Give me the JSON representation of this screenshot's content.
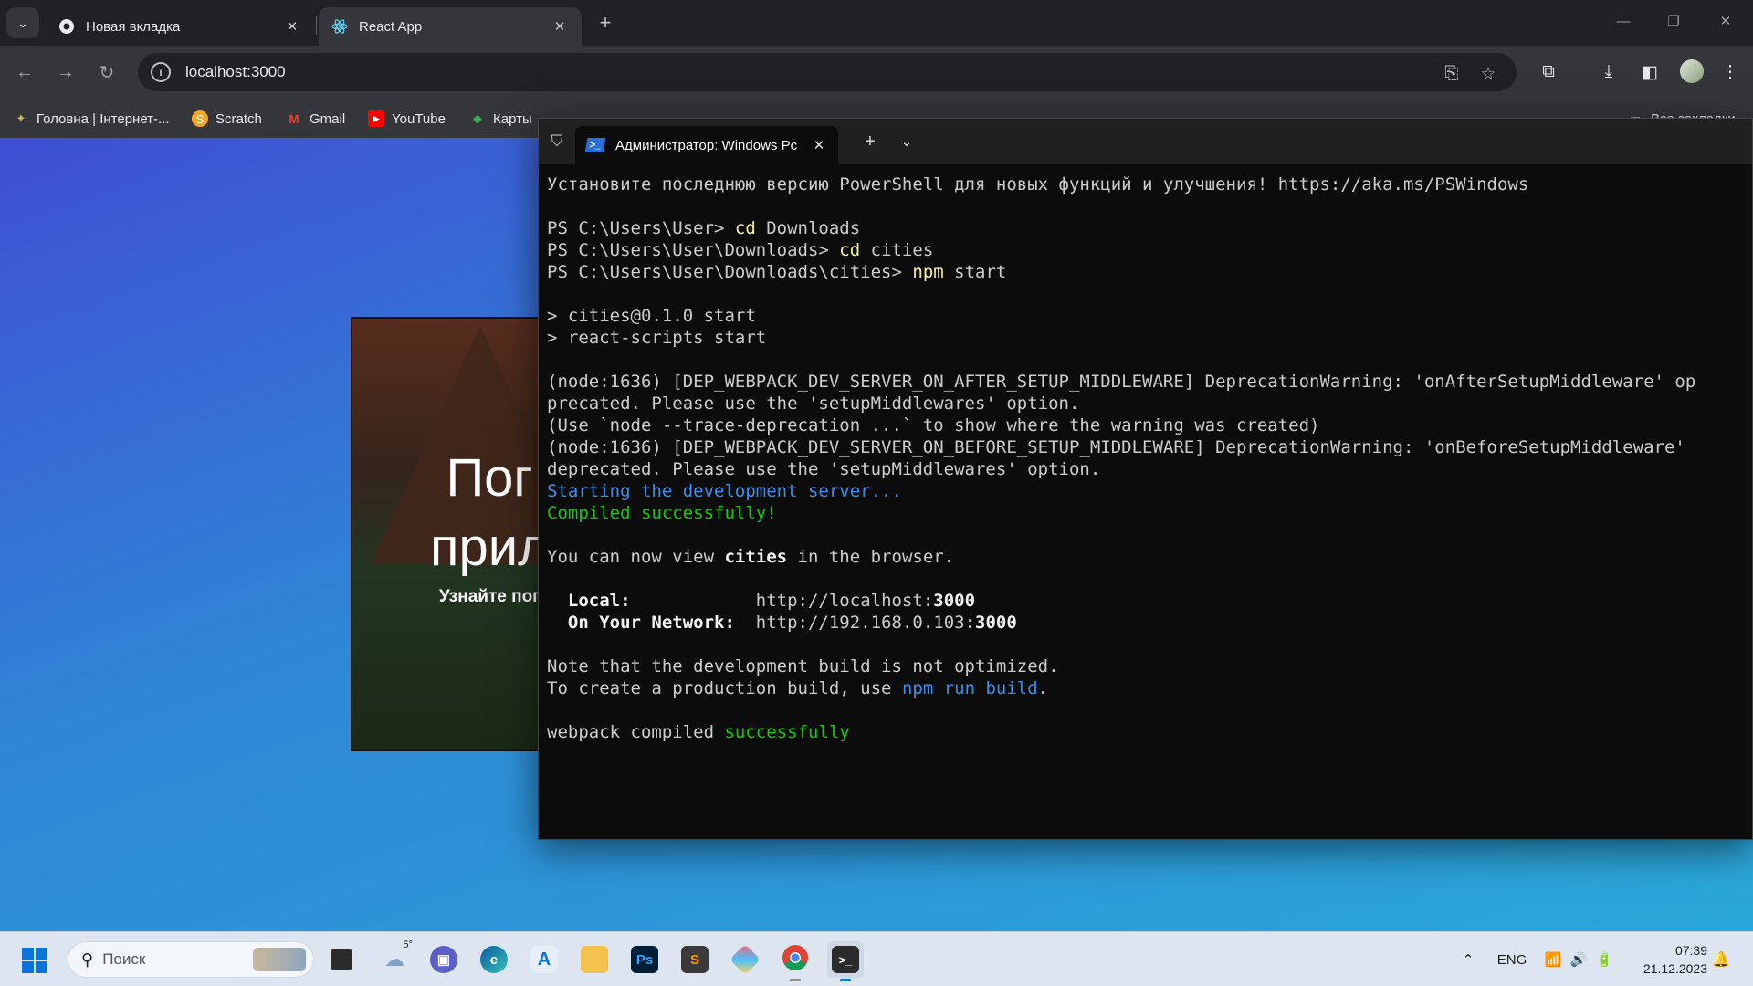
{
  "browser": {
    "tabs": [
      {
        "label": "Новая вкладка",
        "active": false
      },
      {
        "label": "React App",
        "active": true
      }
    ],
    "url": "localhost:3000",
    "bookmarks": [
      {
        "label": "Головна | Інтернет-..."
      },
      {
        "label": "Scratch"
      },
      {
        "label": "Gmail"
      },
      {
        "label": "YouTube"
      },
      {
        "label": "Карты"
      }
    ],
    "all_bookmarks_label": "Все закладки"
  },
  "page": {
    "hero_title_line1": "Пог",
    "hero_title_line2": "прил",
    "hero_subtitle": "Узнайте пог"
  },
  "terminal": {
    "tab_title": "Администратор: Windows Pc",
    "lines": [
      [
        {
          "t": "Установите последнюю версию PowerShell для новых функций и улучшения! https://aka.ms/PSWindows",
          "c": ""
        }
      ],
      [],
      [
        {
          "t": "PS C:\\Users\\User> ",
          "c": ""
        },
        {
          "t": "cd",
          "c": "yel"
        },
        {
          "t": " Downloads",
          "c": ""
        }
      ],
      [
        {
          "t": "PS C:\\Users\\User\\Downloads> ",
          "c": ""
        },
        {
          "t": "cd",
          "c": "yel"
        },
        {
          "t": " cities",
          "c": ""
        }
      ],
      [
        {
          "t": "PS C:\\Users\\User\\Downloads\\cities> ",
          "c": ""
        },
        {
          "t": "npm",
          "c": "yel"
        },
        {
          "t": " start",
          "c": ""
        }
      ],
      [],
      [
        {
          "t": "> cities@0.1.0 start",
          "c": ""
        }
      ],
      [
        {
          "t": "> react-scripts start",
          "c": ""
        }
      ],
      [],
      [
        {
          "t": "(node:1636) [DEP_WEBPACK_DEV_SERVER_ON_AFTER_SETUP_MIDDLEWARE] DeprecationWarning: 'onAfterSetupMiddleware' op",
          "c": ""
        }
      ],
      [
        {
          "t": "precated. Please use the 'setupMiddlewares' option.",
          "c": ""
        }
      ],
      [
        {
          "t": "(Use `node --trace-deprecation ...` to show where the warning was created)",
          "c": ""
        }
      ],
      [
        {
          "t": "(node:1636) [DEP_WEBPACK_DEV_SERVER_ON_BEFORE_SETUP_MIDDLEWARE] DeprecationWarning: 'onBeforeSetupMiddleware'",
          "c": ""
        }
      ],
      [
        {
          "t": "deprecated. Please use the 'setupMiddlewares' option.",
          "c": ""
        }
      ],
      [
        {
          "t": "Starting the development server...",
          "c": "blue"
        }
      ],
      [
        {
          "t": "Compiled successfully!",
          "c": "grn2"
        }
      ],
      [],
      [
        {
          "t": "You can now view ",
          "c": ""
        },
        {
          "t": "cities",
          "c": "bold"
        },
        {
          "t": " in the browser.",
          "c": ""
        }
      ],
      [],
      [
        {
          "t": "  ",
          "c": ""
        },
        {
          "t": "Local:",
          "c": "bold"
        },
        {
          "t": "            http://localhost:",
          "c": ""
        },
        {
          "t": "3000",
          "c": "bold"
        }
      ],
      [
        {
          "t": "  ",
          "c": ""
        },
        {
          "t": "On Your Network:",
          "c": "bold"
        },
        {
          "t": "  http://192.168.0.103:",
          "c": ""
        },
        {
          "t": "3000",
          "c": "bold"
        }
      ],
      [],
      [
        {
          "t": "Note that the development build is not optimized.",
          "c": ""
        }
      ],
      [
        {
          "t": "To create a production build, use ",
          "c": ""
        },
        {
          "t": "npm run build",
          "c": "blue"
        },
        {
          "t": ".",
          "c": ""
        }
      ],
      [],
      [
        {
          "t": "webpack compiled ",
          "c": ""
        },
        {
          "t": "successfully",
          "c": "grn2"
        }
      ]
    ]
  },
  "taskbar": {
    "search_placeholder": "Поиск",
    "weather_temp": "5°",
    "language": "ENG",
    "time": "07:39",
    "date": "21.12.2023"
  },
  "colors": {
    "terminal_bg": "#0c0c0c",
    "command_yellow": "#f9f1a5",
    "info_blue": "#3b8eea",
    "success_green": "#16c60c"
  }
}
